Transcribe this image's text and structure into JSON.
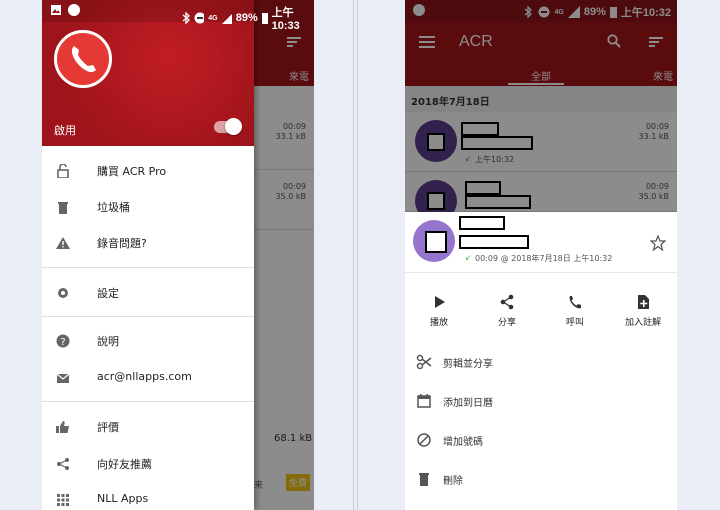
{
  "status_bar": {
    "battery": "89%",
    "network": "4G",
    "time_left": "上午10:33",
    "time_right": "上午10:32"
  },
  "left_screen": {
    "drawer": {
      "enable_label": "啟用",
      "items": [
        {
          "label": "購買 ACR Pro",
          "icon": "lock-open-icon"
        },
        {
          "label": "垃圾桶",
          "icon": "trash-icon"
        },
        {
          "label": "錄音問題?",
          "icon": "warning-icon"
        },
        {
          "label": "設定",
          "icon": "gear-icon"
        },
        {
          "label": "說明",
          "icon": "help-icon"
        },
        {
          "label": "acr@nllapps.com",
          "icon": "email-icon"
        },
        {
          "label": "評價",
          "icon": "thumb-up-icon"
        },
        {
          "label": "向好友推薦",
          "icon": "share-icon"
        },
        {
          "label": "NLL Apps",
          "icon": "apps-grid-icon"
        }
      ]
    },
    "background": {
      "tab_partial": "來電",
      "rows": [
        {
          "duration": "00:09",
          "size": "33.1 kB"
        },
        {
          "duration": "00:09",
          "size": "35.0 kB"
        }
      ],
      "storage": "68.1 kB",
      "button_partial": "免費",
      "text_partial": "来"
    }
  },
  "right_screen": {
    "app_title": "ACR",
    "tabs": {
      "all": "全部",
      "incoming_partial": "來電"
    },
    "date_header": "2018年7月18日",
    "rows": [
      {
        "time": "上午10:32",
        "duration": "00:09",
        "size": "33.1 kB"
      },
      {
        "duration": "00:09",
        "size": "35.0 kB"
      }
    ],
    "sheet": {
      "meta": "00:09 @ 2018年7月18日 上午10:32",
      "actions": [
        {
          "label": "播放",
          "icon": "play-icon"
        },
        {
          "label": "分享",
          "icon": "share-icon"
        },
        {
          "label": "呼叫",
          "icon": "phone-icon"
        },
        {
          "label": "加入註解",
          "icon": "note-add-icon"
        }
      ],
      "options": [
        {
          "label": "剪輯並分享",
          "icon": "scissors-icon"
        },
        {
          "label": "添加到日曆",
          "icon": "calendar-icon"
        },
        {
          "label": "增加號碼",
          "icon": "block-icon"
        },
        {
          "label": "刪除",
          "icon": "delete-icon"
        }
      ]
    }
  },
  "colors": {
    "brand_red": "#a5141b",
    "dark_red": "#8e1419",
    "avatar_purple": "#9575cd",
    "accent_green": "#4caf50"
  }
}
